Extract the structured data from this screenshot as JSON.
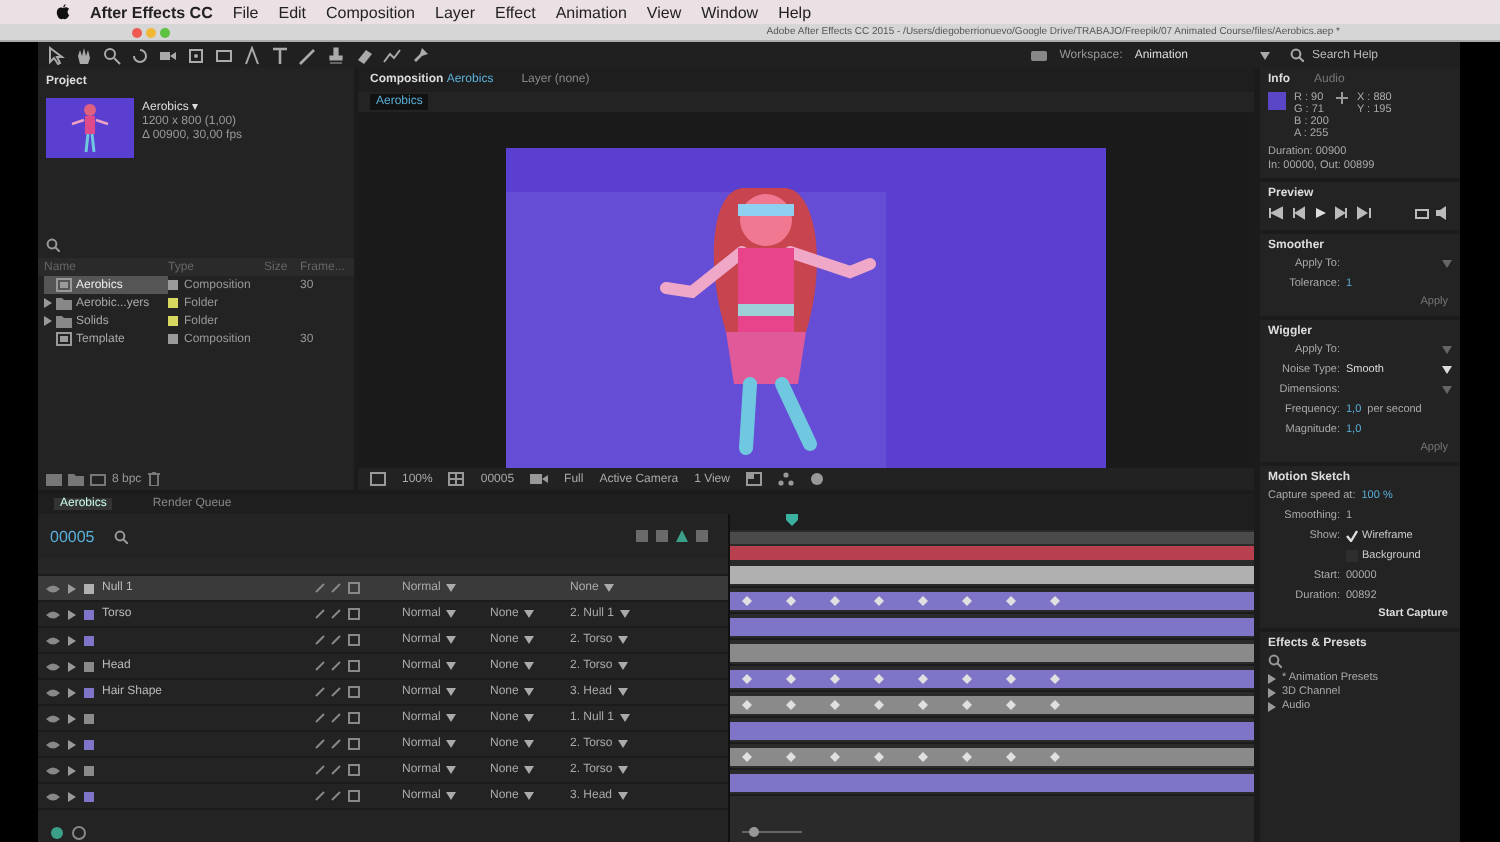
{
  "menu_bar": {
    "items": [
      {
        "kind": "app",
        "label": "After Effects CC"
      },
      {
        "kind": "menu",
        "label": "File"
      },
      {
        "kind": "menu",
        "label": "Edit"
      },
      {
        "kind": "menu",
        "label": "Composition"
      },
      {
        "kind": "menu",
        "label": "Layer"
      },
      {
        "kind": "menu",
        "label": "Effect"
      },
      {
        "kind": "menu",
        "label": "Animation"
      },
      {
        "kind": "menu",
        "label": "View"
      },
      {
        "kind": "menu",
        "label": "Window"
      },
      {
        "kind": "menu",
        "label": "Help"
      }
    ]
  },
  "window": {
    "title": "Adobe After Effects CC 2015 - /Users/diegoberrionuevo/Google Drive/TRABAJO/Freepik/07 Animated Course/files/Aerobics.aep *"
  },
  "toolbar": {
    "workspace_label": "Workspace:",
    "workspace": "Animation",
    "search_placeholder": "Search Help"
  },
  "project": {
    "title": "Project",
    "comp_name": "Aerobics ▾",
    "comp_size": "1200 x 800 (1,00)",
    "comp_duration": "Δ 00900, 30,00 fps",
    "columns": [
      "Name",
      "Type",
      "Size",
      "Frame..."
    ],
    "items": [
      {
        "kind": "composition",
        "name": "Aerobics",
        "type": "Composition",
        "frame": "30",
        "color": "#9a9a9a",
        "selected": true,
        "expandable": false
      },
      {
        "kind": "folder",
        "name": "Aerobic...yers",
        "type": "Folder",
        "color": "#d8d860",
        "selected": false,
        "expandable": true
      },
      {
        "kind": "folder",
        "name": "Solids",
        "type": "Folder",
        "color": "#d8d860",
        "selected": false,
        "expandable": true
      },
      {
        "kind": "composition",
        "name": "Template",
        "type": "Composition",
        "frame": "30",
        "color": "#9a9a9a",
        "selected": false,
        "expandable": false
      }
    ],
    "bit_depth": "8 bpc"
  },
  "composition": {
    "tabs": [
      {
        "label": "Composition",
        "comp": "Aerobics",
        "selected": true
      },
      {
        "label": "Layer (none)",
        "selected": false
      }
    ],
    "breadcrumb": "Aerobics",
    "zoom": "100%",
    "time": "00005",
    "resolution": "Full",
    "camera": "Active Camera",
    "views": "1 View"
  },
  "info": {
    "tabs": [
      {
        "label": "Info",
        "selected": true
      },
      {
        "label": "Audio",
        "selected": false
      }
    ],
    "r": "R : 90",
    "g": "G : 71",
    "b": "B : 200",
    "a": "A : 255",
    "x": "X : 880",
    "y": "Y : 195",
    "duration": "Duration: 00900",
    "in_out": "In: 00000, Out: 00899"
  },
  "preview": {
    "title": "Preview"
  },
  "smoother": {
    "title": "Smoother",
    "apply_to_label": "Apply To:",
    "tolerance_label": "Tolerance:",
    "tolerance": "1",
    "apply": "Apply"
  },
  "wiggler": {
    "title": "Wiggler",
    "apply_to_label": "Apply To:",
    "noise_label": "Noise Type:",
    "noise": "Smooth",
    "dimensions_label": "Dimensions:",
    "frequency_label": "Frequency:",
    "frequency": "1,0",
    "frequency_unit": "per second",
    "magnitude_label": "Magnitude:",
    "magnitude": "1,0",
    "apply": "Apply"
  },
  "motion_sketch": {
    "title": "Motion Sketch",
    "speed_label": "Capture speed at:",
    "speed": "100 %",
    "smoothing_label": "Smoothing:",
    "smoothing": "1",
    "show_label": "Show:",
    "options": [
      {
        "label": "Wireframe",
        "checked": true
      },
      {
        "label": "Background",
        "checked": false
      }
    ],
    "start_label": "Start:",
    "start": "00000",
    "duration_label": "Duration:",
    "duration": "00892",
    "button": "Start Capture"
  },
  "effects_presets": {
    "title": "Effects & Presets",
    "items": [
      "* Animation Presets",
      "3D Channel",
      "Audio"
    ]
  },
  "timeline": {
    "tabs": [
      {
        "label": "Aerobics",
        "selected": true
      },
      {
        "label": "Render Queue",
        "selected": false
      }
    ],
    "time": "00005",
    "layers": [
      {
        "name": "Null 1",
        "mode": "Normal",
        "parent": "None",
        "color": "#b0b0b0",
        "keyframes": false,
        "selected": true
      },
      {
        "name": "Torso",
        "mode": "Normal",
        "trkmat": "None",
        "parent": "2. Null 1",
        "color": "#7e74c8",
        "keyframes": true,
        "selected": false
      },
      {
        "mode": "Normal",
        "trkmat": "None",
        "parent": "2. Torso",
        "color": "#7e74c8",
        "keyframes": false,
        "selected": false
      },
      {
        "name": "Head",
        "mode": "Normal",
        "trkmat": "None",
        "parent": "2. Torso",
        "color": "#8a8a8a",
        "keyframes": false,
        "selected": false
      },
      {
        "name": "Hair Shape",
        "mode": "Normal",
        "trkmat": "None",
        "parent": "3. Head",
        "color": "#7e74c8",
        "keyframes": true,
        "selected": false
      },
      {
        "mode": "Normal",
        "trkmat": "None",
        "parent": "1. Null 1",
        "color": "#8a8a8a",
        "keyframes": true,
        "selected": false
      },
      {
        "mode": "Normal",
        "trkmat": "None",
        "parent": "2. Torso",
        "color": "#7e74c8",
        "keyframes": false,
        "selected": false
      },
      {
        "mode": "Normal",
        "trkmat": "None",
        "parent": "2. Torso",
        "color": "#8a8a8a",
        "keyframes": true,
        "selected": false
      },
      {
        "mode": "Normal",
        "trkmat": "None",
        "parent": "3. Head",
        "color": "#7e74c8",
        "keyframes": false,
        "selected": false
      }
    ]
  }
}
